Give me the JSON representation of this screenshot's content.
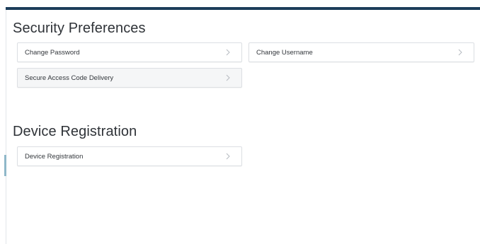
{
  "security_preferences": {
    "title": "Security Preferences",
    "items": [
      {
        "label": "Change Password"
      },
      {
        "label": "Change Username"
      },
      {
        "label": "Secure Access Code Delivery"
      }
    ]
  },
  "device_registration": {
    "title": "Device Registration",
    "items": [
      {
        "label": "Device Registration"
      }
    ]
  },
  "icons": {
    "item_arrow": "chevron-right-icon"
  },
  "colors": {
    "header_bar": "#1c3d5a",
    "accent": "#8fb8c9",
    "card_border": "#dcdfe3",
    "text": "#2f3338"
  }
}
